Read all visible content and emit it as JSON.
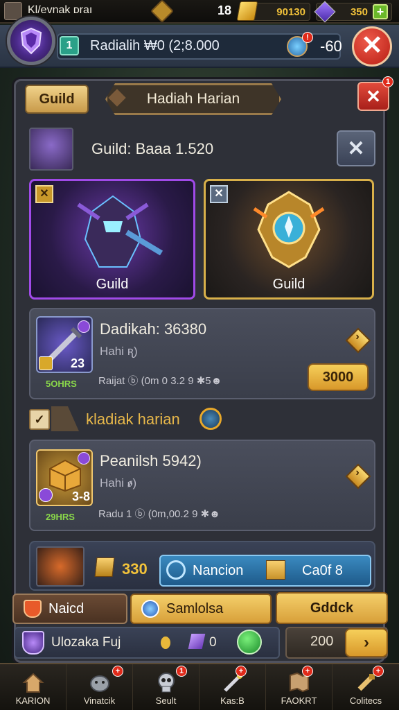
{
  "top_bar": {
    "player_name": "Kl/evnak ᴅraı",
    "count": "18",
    "gold": "90130",
    "gems": "350",
    "plus": "+"
  },
  "header": {
    "level": "1",
    "message": "Radialih ₩0 (2;8.000",
    "reward_value": "-60",
    "close": "✕"
  },
  "panel": {
    "guild_tab": "Guild",
    "title_tab": "Hadiah Harian",
    "close": "✕",
    "notif": "1",
    "guild_info": "Guild: Baaa 1.520",
    "info_close": "✕"
  },
  "guild_cards": [
    {
      "label": "Guild",
      "corner": "✕"
    },
    {
      "label": "Guild",
      "corner": "✕"
    }
  ],
  "reward1": {
    "title": "Dadikah: 36380",
    "subtitle": "Hahi ꭆ)",
    "qty": "23",
    "days": "5OHRS",
    "detail": "Raijat ⓑ (0m 0 3.2 9 ✱5☻",
    "button": "3000",
    "arrow": "›"
  },
  "section": {
    "label": "kladiak harian",
    "check": "✓"
  },
  "reward2": {
    "title": "Peanilsh 5942)",
    "subtitle": "Hahi ꬾ)",
    "qty": "3-8",
    "days": "29HRS",
    "detail": "Radu 1 ⓑ (0m,00.2 9 ✱☻",
    "arrow": "›"
  },
  "footer_row": {
    "amount": "330",
    "nation": "Nancion",
    "cap": "Ca0f 8"
  },
  "action_tabs": {
    "naicd": "Naicd",
    "samlolsa": "Samlolsa",
    "gddck": "Gddck"
  },
  "status_row": {
    "name": "Ulozaka Fuj",
    "count": "0",
    "value": "200",
    "arrow": "›"
  },
  "nav": [
    {
      "label": "KARION",
      "icon": "home-icon",
      "badge": ""
    },
    {
      "label": "Vinatcik",
      "icon": "creature-icon",
      "badge": "+"
    },
    {
      "label": "Seult",
      "icon": "skull-icon",
      "badge": "1"
    },
    {
      "label": "Kas:B",
      "icon": "wand-icon",
      "badge": "+"
    },
    {
      "label": "FAOKRT",
      "icon": "map-icon",
      "badge": "+"
    },
    {
      "label": "Colitecs",
      "icon": "scroll-icon",
      "badge": "+"
    }
  ],
  "colors": {
    "gold": "#f2c23a",
    "green": "#2aa088",
    "purple": "#8a4ad8",
    "red_close": "#d23a2a",
    "panel_bg": "#2e3038"
  }
}
